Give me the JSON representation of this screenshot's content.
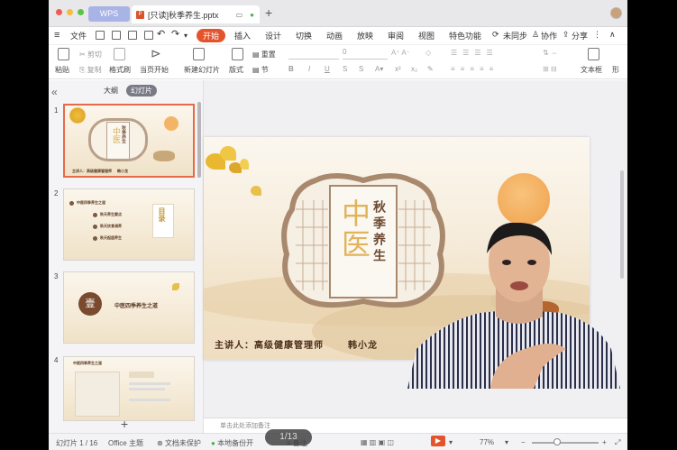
{
  "app": {
    "wps_tab": "WPS",
    "doc_tab_title": "[只读]秋季养生.pptx"
  },
  "menu": {
    "file": "文件",
    "tabs": [
      "开始",
      "插入",
      "设计",
      "切换",
      "动画",
      "放映",
      "审阅",
      "视图",
      "特色功能"
    ],
    "sync": "未同步",
    "collab": "协作",
    "share": "分享"
  },
  "ribbon": {
    "paste": "粘贴",
    "cut": "剪切",
    "copy": "复制",
    "format_painter": "格式刷",
    "play_from_current": "当页开始",
    "new_slide": "新建幻灯片",
    "layout": "版式",
    "reset": "重置",
    "section": "节",
    "font_size": "0",
    "textbox": "文本框",
    "shape": "形"
  },
  "sidebar": {
    "outline_label": "大纲",
    "slides_label": "幻灯片",
    "slide_numbers": [
      "1",
      "2",
      "3",
      "4"
    ],
    "thumb1": {
      "title": "中医",
      "subtitle": "秋季养生",
      "presenter": "主讲人：高级健康管理师",
      "name": "韩小龙"
    },
    "thumb2": {
      "heading": "目录",
      "items": [
        "中医四季养生之道",
        "秋天养生要点",
        "秋天饮食调养",
        "秋天起居养生"
      ]
    },
    "thumb3": {
      "badge": "壹",
      "title": "中医四季养生之道"
    },
    "thumb4": {
      "title": "中医四季养生之道"
    }
  },
  "slide": {
    "title_big": "中医",
    "subtitle": "秋季养生",
    "presenter": "主讲人：高级健康管理师",
    "name": "韩小龙"
  },
  "notes_placeholder": "单击此处添加备注",
  "status": {
    "slide_counter": "幻灯片 1 / 16",
    "theme": "Office 主题",
    "protect": "文档未保护",
    "backup": "本地备份开",
    "notes": "备注",
    "zoom": "77%",
    "page_overlay": "1/13"
  },
  "colors": {
    "accent": "#e4542c",
    "wps_tab": "#a9b4e6",
    "gold": "#c79a3c",
    "brown": "#7a5a44"
  }
}
